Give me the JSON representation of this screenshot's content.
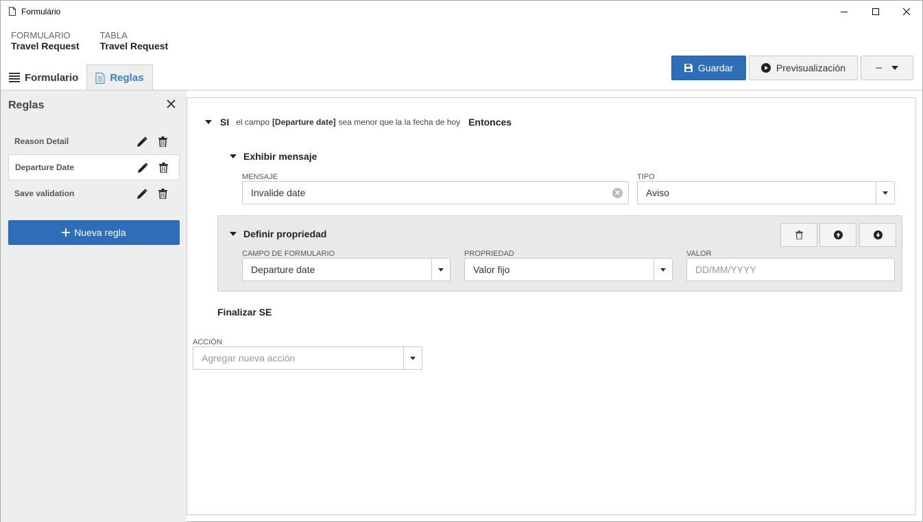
{
  "window": {
    "title": "Formulário",
    "icons": {
      "document": "document-icon",
      "minimize": "minimize-icon",
      "maximize": "maximize-icon",
      "close": "close-icon"
    }
  },
  "header": {
    "form_label": "FORMULARIO",
    "form_value": "Travel Request",
    "table_label": "TABLA",
    "table_value": "Travel Request"
  },
  "tabs": [
    {
      "label": "Formulario",
      "icon": "form-list-icon",
      "active": false
    },
    {
      "label": "Reglas",
      "icon": "rules-document-icon",
      "active": true
    }
  ],
  "toolbar": {
    "save_label": "Guardar",
    "preview_label": "Previsualización",
    "more_label": "···"
  },
  "sidebar": {
    "title": "Reglas",
    "rules": [
      {
        "label": "Reason Detail",
        "selected": false
      },
      {
        "label": "Departure Date",
        "selected": true
      },
      {
        "label": "Save validation",
        "selected": false
      }
    ],
    "new_rule_label": "Nueva regla"
  },
  "rule": {
    "if_keyword": "SI",
    "condition_prefix": "el campo",
    "condition_field": "[Departure date]",
    "condition_suffix": "sea menor que la la fecha de hoy",
    "then_keyword": "Entonces",
    "show_message": {
      "title": "Exhibir mensaje",
      "message_label": "MENSAJE",
      "message_value": "Invalide date",
      "type_label": "TIPO",
      "type_value": "Aviso"
    },
    "define_property": {
      "title": "Definir propriedad",
      "field_label": "CAMPO DE FORMULARIO",
      "field_value": "Departure date",
      "property_label": "PROPRIEDAD",
      "property_value": "Valor fijo",
      "value_label": "VALOR",
      "value_placeholder": "DD/MM/YYYY"
    },
    "end_label": "Finalizar SE"
  },
  "action": {
    "label": "ACCIÓN",
    "placeholder": "Agregar nueva acción"
  },
  "colors": {
    "primary": "#2e6eb8",
    "active_tab": "#3a7fc0",
    "sidebar_bg": "#eceef0"
  }
}
